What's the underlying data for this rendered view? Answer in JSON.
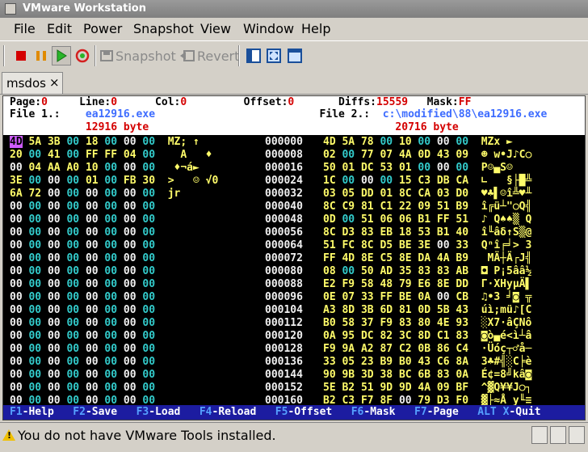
{
  "window": {
    "title": "VMware Workstation"
  },
  "menu": [
    "File",
    "Edit",
    "Power",
    "Snapshot",
    "View",
    "Window",
    "Help"
  ],
  "toolbar": {
    "snapshot_label": "Snapshot",
    "revert_label": "Revert"
  },
  "tab": {
    "label": "msdos",
    "close": "×"
  },
  "header": {
    "line1": [
      {
        "t": "Page:",
        "c": "w"
      },
      {
        "t": "0",
        "c": "r"
      },
      {
        "t": "     Line:",
        "c": "w"
      },
      {
        "t": "0",
        "c": "r"
      },
      {
        "t": "      Col:",
        "c": "w"
      },
      {
        "t": "0",
        "c": "r"
      },
      {
        "t": "         Offset:",
        "c": "w"
      },
      {
        "t": "0",
        "c": "r"
      },
      {
        "t": "       Diffs:",
        "c": "w"
      },
      {
        "t": "15559",
        "c": "r"
      },
      {
        "t": "   Mask:",
        "c": "w"
      },
      {
        "t": "FF",
        "c": "r"
      }
    ],
    "line2": [
      {
        "t": "File 1.:",
        "c": "w"
      },
      {
        "t": "    ea12916.exe",
        "c": "bl"
      },
      {
        "t": "                          File 2.: ",
        "c": "w"
      },
      {
        "t": " c:\\modified\\88\\ea12916.exe",
        "c": "bl"
      }
    ],
    "line3": [
      {
        "t": "            12916 byte",
        "c": "r"
      },
      {
        "t": "                                       20716 byte",
        "c": "r"
      }
    ]
  },
  "rows": [
    {
      "l": "4D 5A 3B 00 18 00 00 00",
      "la": "MZ; ↑   ",
      "off": "000000",
      "r": "4D 5A 78 00 10 00 00 00",
      "ra": "MZx ►   "
    },
    {
      "l": "20 00 41 00 FF FF 04 00",
      "la": "  A   ♦ ",
      "off": "000008",
      "r": "02 00 77 07 4A 0D 43 09",
      "ra": "☻ w•J♪C○"
    },
    {
      "l": "00 04 AA A0 10 00 00 00",
      "la": " ♦¬á►   ",
      "off": "000016",
      "r": "50 01 DC 53 01 00 00 00",
      "ra": "P☺▄S☺   "
    },
    {
      "l": "3E 00 00 00 01 00 FB 30",
      "la": ">   ☺ √0",
      "off": "000024",
      "r": "1C 00 00 00 15 C3 DB CA",
      "ra": "∟   §├█╩"
    },
    {
      "l": "6A 72 00 00 00 00 00 00",
      "la": "jr      ",
      "off": "000032",
      "r": "03 05 DD 01 8C CA 03 D0",
      "ra": "♥♣▌☺î╩♥╨"
    },
    {
      "l": "00 00 00 00 00 00 00 00",
      "la": "        ",
      "off": "000040",
      "r": "8C C9 81 C1 22 09 51 B9",
      "ra": "î╔ü┴\"○Q╣"
    },
    {
      "l": "00 00 00 00 00 00 00 00",
      "la": "        ",
      "off": "000048",
      "r": "0D 00 51 06 06 B1 FF 51",
      "ra": "♪ Q♠♠▒ Q"
    },
    {
      "l": "00 00 00 00 00 00 00 00",
      "la": "        ",
      "off": "000056",
      "r": "8C D3 83 EB 18 53 B1 40",
      "ra": "î╙âδ↑S▒@"
    },
    {
      "l": "00 00 00 00 00 00 00 00",
      "la": "        ",
      "off": "000064",
      "r": "51 FC 8C D5 BE 3E 00 33",
      "ra": "Qⁿî╒╛> 3"
    },
    {
      "l": "00 00 00 00 00 00 00 00",
      "la": "        ",
      "off": "000072",
      "r": "FF 4D 8E C5 8E DA 4A B9",
      "ra": " MÄ┼Ä┌J╣"
    },
    {
      "l": "00 00 00 00 00 00 00 00",
      "la": "        ",
      "off": "000080",
      "r": "08 00 50 AD 35 83 83 AB",
      "ra": "◘ P¡5ââ½"
    },
    {
      "l": "00 00 00 00 00 00 00 00",
      "la": "        ",
      "off": "000088",
      "r": "E2 F9 58 48 79 E6 8E DD",
      "ra": "Γ·XHyµÄ▌"
    },
    {
      "l": "00 00 00 00 00 00 00 00",
      "la": "        ",
      "off": "000096",
      "r": "0E 07 33 FF BE 0A 00 CB",
      "ra": "♫•3 ╛◙ ╦"
    },
    {
      "l": "00 00 00 00 00 00 00 00",
      "la": "        ",
      "off": "000104",
      "r": "A3 8D 3B 6D 81 0D 5B 43",
      "ra": "úì;mü♪[C"
    },
    {
      "l": "00 00 00 00 00 00 00 00",
      "la": "        ",
      "off": "000112",
      "r": "B0 58 37 F9 83 80 4E 93",
      "ra": "░X7·âÇNô"
    },
    {
      "l": "00 00 00 00 00 00 00 00",
      "la": "        ",
      "off": "000120",
      "r": "0A 95 DC 82 3C 8D C1 83",
      "ra": "◙ò▄é<ì┴â"
    },
    {
      "l": "00 00 00 00 00 00 00 00",
      "la": "        ",
      "off": "000128",
      "r": "F9 9A A2 87 C2 0B 86 C4",
      "ra": "·Üóç┬♂å─"
    },
    {
      "l": "00 00 00 00 00 00 00 00",
      "la": "        ",
      "off": "000136",
      "r": "33 05 23 B9 B0 43 C6 8A",
      "ra": "3♣#╣░C╞è"
    },
    {
      "l": "00 00 00 00 00 00 00 00",
      "la": "        ",
      "off": "000144",
      "r": "90 9B 3D 38 BC 6B 83 0A",
      "ra": "É¢=8╝kâ◙"
    },
    {
      "l": "00 00 00 00 00 00 00 00",
      "la": "        ",
      "off": "000152",
      "r": "5E B2 51 9D 9D 4A 09 BF",
      "ra": "^▓Q¥¥J○┐"
    },
    {
      "l": "00 00 00 00 00 00 00 00",
      "la": "        ",
      "off": "000160",
      "r": "B2 C3 F7 8F 00 79 D3 F0",
      "ra": "▓├≈Å y╙≡"
    }
  ],
  "fkeys": [
    {
      "k": "F1",
      "l": "-Help"
    },
    {
      "k": "F2",
      "l": "-Save"
    },
    {
      "k": "F3",
      "l": "-Load"
    },
    {
      "k": "F4",
      "l": "-Reload"
    },
    {
      "k": "F5",
      "l": "-Offset"
    },
    {
      "k": "F6",
      "l": "-Mask"
    },
    {
      "k": "F7",
      "l": "-Page"
    },
    {
      "k": "ALT X",
      "l": "-Quit"
    }
  ],
  "status": {
    "message": "You do not have VMware Tools installed."
  }
}
